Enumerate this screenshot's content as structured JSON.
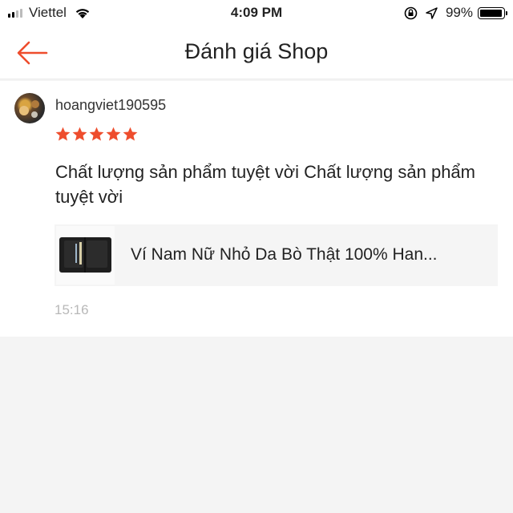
{
  "status_bar": {
    "carrier": "Viettel",
    "time": "4:09 PM",
    "battery_percent": "99%",
    "icons": [
      "signal-icon",
      "wifi-icon",
      "orientation-lock-icon",
      "location-icon",
      "battery-icon"
    ]
  },
  "nav": {
    "title": "Đánh giá Shop",
    "back_icon": "arrow-left-icon",
    "accent_color": "#ee4d2d"
  },
  "review": {
    "username": "hoangviet190595",
    "rating": 5,
    "rating_max": 5,
    "star_color": "#ee4d2d",
    "text": "Chất lượng sản phẩm tuyệt vời Chất lượng sản phẩm tuyệt vời",
    "product": {
      "name": "Ví Nam Nữ Nhỏ Da Bò Thật 100% Han..."
    },
    "time": "15:16"
  }
}
